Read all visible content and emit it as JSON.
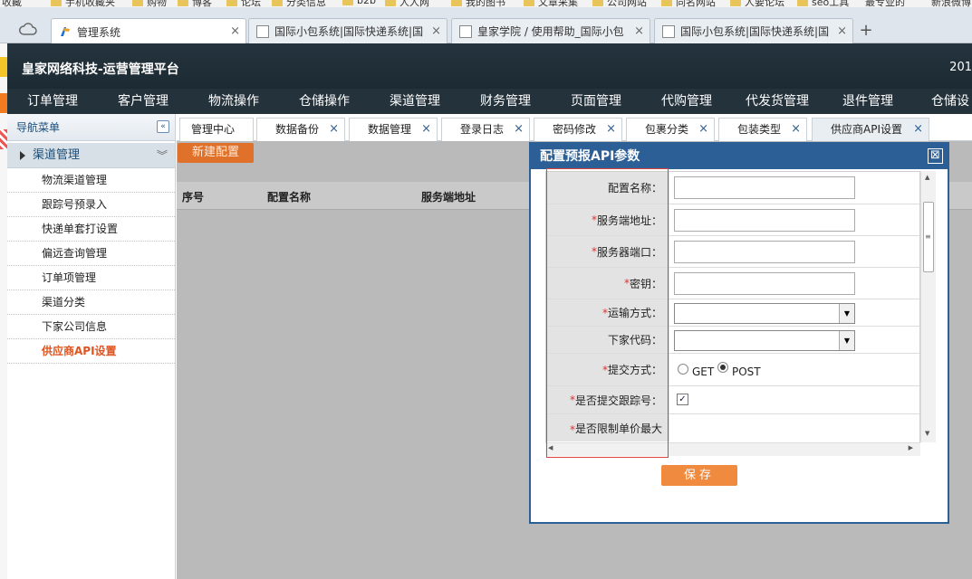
{
  "browser": {
    "bookmarks": [
      "收藏",
      "手机收藏夹",
      "购物",
      "博客",
      "论坛",
      "分类信息",
      "b2b",
      "人人网",
      "我的图书",
      "文章采集",
      "公司网站",
      "同名网站",
      "人要论坛",
      "seo工具",
      "最专业的",
      "新浪微博"
    ],
    "tabs": [
      {
        "label": "管理系统",
        "active": true
      },
      {
        "label": "国际小包系统|国际快递系统|国",
        "active": false
      },
      {
        "label": "皇家学院 / 使用帮助_国际小包",
        "active": false
      },
      {
        "label": "国际小包系统|国际快递系统|国",
        "active": false
      }
    ],
    "new_tab": "+",
    "close_glyph": "×"
  },
  "app": {
    "title": "皇家网络科技-运营管理平台",
    "year": "201"
  },
  "mainnav": [
    "订单管理",
    "客户管理",
    "物流操作",
    "仓储操作",
    "渠道管理",
    "财务管理",
    "页面管理",
    "代购管理",
    "代发货管理",
    "退件管理",
    "仓储设"
  ],
  "sidebar": {
    "title": "导航菜单",
    "collapse": "«",
    "group": "渠道管理",
    "group_chevron": "︾",
    "items": [
      "物流渠道管理",
      "跟踪号预录入",
      "快递单套打设置",
      "偏远查询管理",
      "订单项管理",
      "渠道分类",
      "下家公司信息",
      "供应商API设置"
    ]
  },
  "content_tabs": [
    {
      "label": "管理中心",
      "closable": false
    },
    {
      "label": "数据备份",
      "closable": true
    },
    {
      "label": "数据管理",
      "closable": true
    },
    {
      "label": "登录日志",
      "closable": true
    },
    {
      "label": "密码修改",
      "closable": true
    },
    {
      "label": "包裹分类",
      "closable": true
    },
    {
      "label": "包装类型",
      "closable": true
    },
    {
      "label": "供应商API设置",
      "closable": true
    }
  ],
  "content": {
    "new_button": "新建配置",
    "columns": [
      "序号",
      "配置名称",
      "服务端地址"
    ]
  },
  "modal": {
    "title": "配置预报API参数",
    "close": "⊠",
    "fields": [
      {
        "label": "配置名称：",
        "required": false,
        "type": "text",
        "value": ""
      },
      {
        "label": "服务端地址：",
        "required": true,
        "type": "text",
        "value": ""
      },
      {
        "label": "服务器端口：",
        "required": true,
        "type": "text",
        "value": ""
      },
      {
        "label": "密钥：",
        "required": true,
        "type": "text",
        "value": ""
      },
      {
        "label": "运输方式：",
        "required": true,
        "type": "select",
        "value": ""
      },
      {
        "label": "下家代码：",
        "required": false,
        "type": "select",
        "value": ""
      },
      {
        "label": "提交方式：",
        "required": true,
        "type": "radio",
        "options": [
          "GET",
          "POST"
        ],
        "selected": "POST"
      },
      {
        "label": "是否提交跟踪号：",
        "required": true,
        "type": "checkbox",
        "checked": true
      },
      {
        "label": "是否限制单价最大",
        "required": true,
        "type": "partial"
      }
    ],
    "required_mark": "*",
    "save_button": "保存",
    "scroll_grip": "≡"
  }
}
